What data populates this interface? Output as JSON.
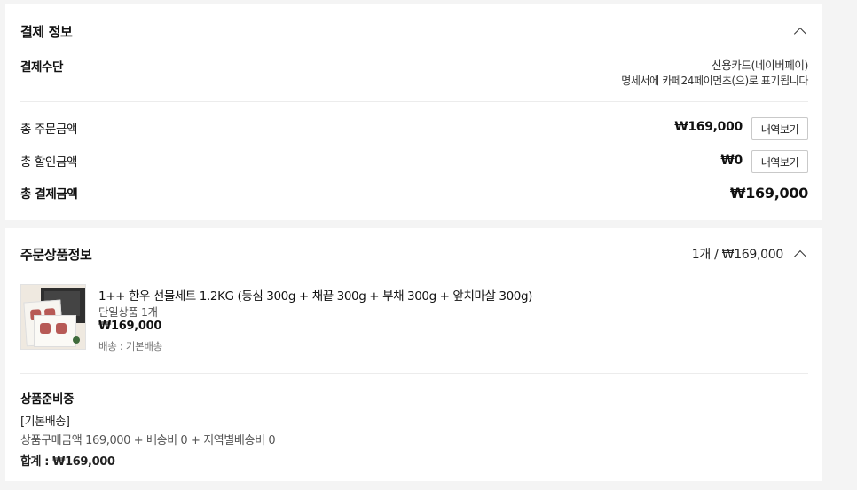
{
  "payment_section": {
    "title": "결제 정보",
    "method_label": "결제수단",
    "method_value": "신용카드(네이버페이)",
    "statement_note": "명세서에 카페24페이먼츠(으)로 표기됩니다",
    "order_total_label": "총 주문금액",
    "order_total_value": "₩169,000",
    "detail_button": "내역보기",
    "discount_label": "총 할인금액",
    "discount_value": "₩0",
    "payment_total_label": "총 결제금액",
    "payment_total_value": "₩169,000"
  },
  "order_section": {
    "title": "주문상품정보",
    "summary": "1개 / ₩169,000",
    "product": {
      "name": "1++ 한우 선물세트 1.2KG (등심 300g + 채끝 300g + 부채 300g + 앞치마살 300g)",
      "option": "단일상품 1개",
      "price": "₩169,000",
      "shipping": "배송 : 기본배송"
    },
    "status": "상품준비중",
    "shipping_type": "[기본배송]",
    "shipping_calc": "상품구매금액 169,000 + 배송비 0 + 지역별배송비 0",
    "sum_label": "합계 : ",
    "sum_value": "₩169,000"
  },
  "icons": [
    "chevron-up-icon"
  ]
}
